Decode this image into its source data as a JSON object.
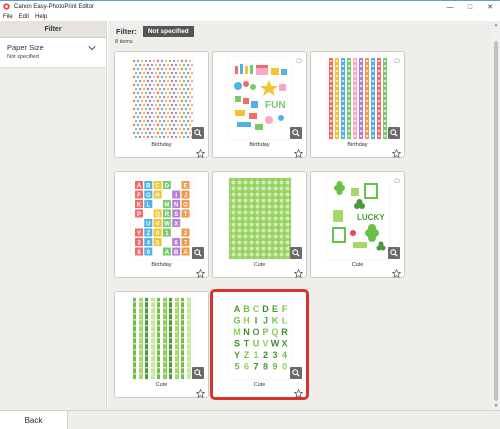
{
  "window": {
    "title": "Canon Easy-PhotoPrint Editor",
    "controls": [
      "—",
      "□",
      "✕"
    ]
  },
  "menu": [
    "File",
    "Edit",
    "Help"
  ],
  "sidebar": {
    "header": "Filter",
    "paper_size": {
      "title": "Paper Size",
      "value": "Not specified",
      "icon": "chevron-down-icon"
    }
  },
  "main": {
    "filter_label": "Filter:",
    "filter_badge": "Not specified",
    "item_count": "8 items",
    "items": [
      {
        "label": "Birthday",
        "pattern": "confetti-dots",
        "cloud": false,
        "selected": false
      },
      {
        "label": "Birthday",
        "pattern": "birthday-stickers",
        "cloud": true,
        "selected": false
      },
      {
        "label": "Birthday",
        "pattern": "ribbon-stripes",
        "cloud": true,
        "selected": false
      },
      {
        "label": "Birthday",
        "pattern": "alphabet-blocks",
        "cloud": false,
        "selected": false
      },
      {
        "label": "Cute",
        "pattern": "green-gingham",
        "cloud": false,
        "selected": false
      },
      {
        "label": "Cute",
        "pattern": "clover-stickers",
        "cloud": true,
        "selected": false
      },
      {
        "label": "Cute",
        "pattern": "green-ribbon-stripes",
        "cloud": false,
        "selected": false
      },
      {
        "label": "Cute",
        "pattern": "green-alphabet",
        "cloud": false,
        "selected": true
      }
    ]
  },
  "colors": {
    "selection": "#d9342b",
    "zoom_button": "#6a6a6a",
    "badge": "#555555"
  },
  "footer": {
    "back_label": "Back"
  }
}
